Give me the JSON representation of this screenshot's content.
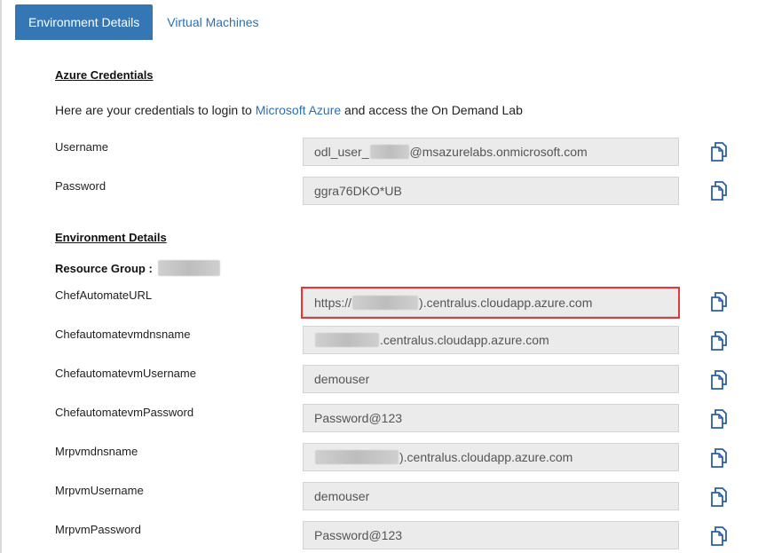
{
  "tabs": [
    {
      "label": "Environment Details",
      "active": true
    },
    {
      "label": "Virtual Machines",
      "active": false
    }
  ],
  "credentials": {
    "title": "Azure Credentials",
    "intro_prefix": "Here are your credentials to login to ",
    "intro_link": "Microsoft Azure",
    "intro_suffix": " and access the On Demand Lab",
    "username_label": "Username",
    "username_prefix": "odl_user_",
    "username_suffix": "@msazurelabs.onmicrosoft.com",
    "password_label": "Password",
    "password_value": "ggra76DKO*UB"
  },
  "environment": {
    "title": "Environment Details",
    "resource_group_label": "Resource Group :",
    "rows": [
      {
        "label": "ChefAutomateURL",
        "prefix": "https://",
        "suffix": ").centralus.cloudapp.azure.com"
      },
      {
        "label": "Chefautomatevmdnsname",
        "prefix": "",
        "suffix": ".centralus.cloudapp.azure.com"
      },
      {
        "label": "ChefautomatevmUsername",
        "prefix": "",
        "suffix": "demouser"
      },
      {
        "label": "ChefautomatevmPassword",
        "prefix": "",
        "suffix": "Password@123"
      },
      {
        "label": "Mrpvmdnsname",
        "prefix": "",
        "suffix": ").centralus.cloudapp.azure.com"
      },
      {
        "label": "MrpvmUsername",
        "prefix": "",
        "suffix": "demouser"
      },
      {
        "label": "MrpvmPassword",
        "prefix": "",
        "suffix": "Password@123"
      }
    ]
  },
  "colors": {
    "accent": "#3577b5",
    "link": "#2a70b8",
    "highlight": "#e03a3a"
  },
  "icons": {
    "copy": "copy-icon"
  }
}
